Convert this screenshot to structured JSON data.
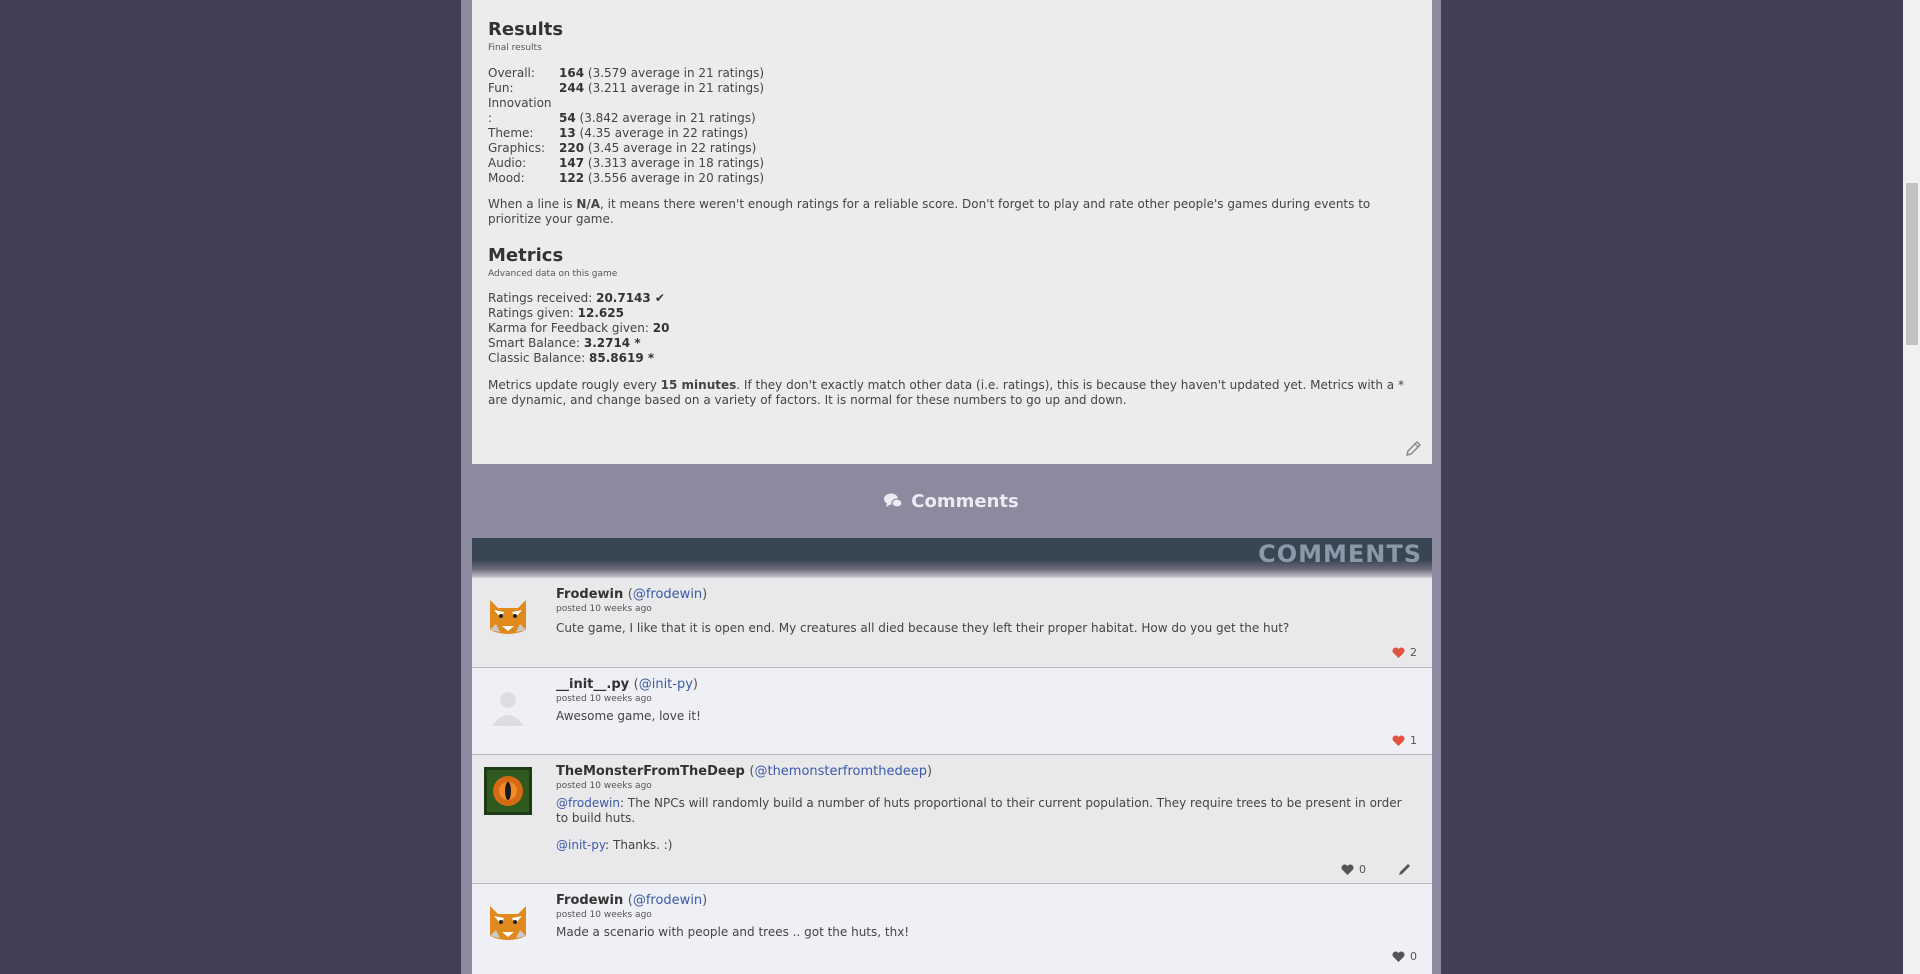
{
  "results": {
    "title": "Results",
    "subtitle": "Final results",
    "rows": [
      {
        "label": "Overall:",
        "rank": "164",
        "detail": "(3.579 average in 21 ratings)"
      },
      {
        "label": "Fun:",
        "rank": "244",
        "detail": "(3.211 average in 21 ratings)"
      },
      {
        "label": "Innovation",
        "rank": "",
        "detail": ""
      },
      {
        "label": ":",
        "rank": "54",
        "detail": "(3.842 average in 21 ratings)"
      },
      {
        "label": "Theme:",
        "rank": "13",
        "detail": "(4.35 average in 22 ratings)"
      },
      {
        "label": "Graphics:",
        "rank": "220",
        "detail": "(3.45 average in 22 ratings)"
      },
      {
        "label": "Audio:",
        "rank": "147",
        "detail": "(3.313 average in 18 ratings)"
      },
      {
        "label": "Mood:",
        "rank": "122",
        "detail": "(3.556 average in 20 ratings)"
      }
    ],
    "note_pre": "When a line is ",
    "note_bold": "N/A",
    "note_post": ", it means there weren't enough ratings for a reliable score. Don't forget to play and rate other people's games during events to prioritize your game."
  },
  "metrics": {
    "title": "Metrics",
    "subtitle": "Advanced data on this game",
    "rows": [
      {
        "label": "Ratings received: ",
        "value": "20.7143 ✔"
      },
      {
        "label": "Ratings given: ",
        "value": "12.625"
      },
      {
        "label": "Karma for Feedback given: ",
        "value": "20"
      },
      {
        "label": "Smart Balance: ",
        "value": "3.2714 *"
      },
      {
        "label": "Classic Balance: ",
        "value": "85.8619 *"
      }
    ],
    "note_pre": "Metrics update rougly every ",
    "note_bold": "15 minutes",
    "note_post": ". If they don't exactly match other data (i.e. ratings), this is because they haven't updated yet. Metrics with a * are dynamic, and change based on a variety of factors. It is normal for these numbers to go up and down."
  },
  "comments_section": {
    "heading": "Comments",
    "banner": "COMMENTS"
  },
  "comments": [
    {
      "author": "Frodewin",
      "handle": "@frodewin",
      "time": "posted 10 weeks ago",
      "text": "Cute game, I like that it is open end. My creatures all died because they left their proper habitat. How do you get the hut?",
      "likes": "2",
      "liked": true,
      "avatar": "cat-avatar"
    },
    {
      "author": "__init__.py",
      "handle": "@init-py",
      "time": "posted 10 weeks ago",
      "text": "Awesome game, love it!",
      "likes": "1",
      "liked": true,
      "avatar": "default-avatar"
    },
    {
      "author": "TheMonsterFromTheDeep",
      "handle": "@themonsterfromthedeep",
      "time": "posted 10 weeks ago",
      "mention1": "@frodewin",
      "text1": ": The NPCs will randomly build a number of huts proportional to their current population. They require trees to be present in order to build huts.",
      "mention2": "@init-py",
      "text2": ": Thanks. :)",
      "likes": "0",
      "liked": false,
      "avatar": "monster-avatar"
    },
    {
      "author": "Frodewin",
      "handle": "@frodewin",
      "time": "posted 10 weeks ago",
      "text": "Made a scenario with people and trees .. got the huts, thx!",
      "likes": "0",
      "liked": false,
      "avatar": "cat-avatar"
    }
  ],
  "colors": {
    "like_active": "#e4533f",
    "like_inactive": "#555555",
    "link": "#3a5aa8"
  }
}
